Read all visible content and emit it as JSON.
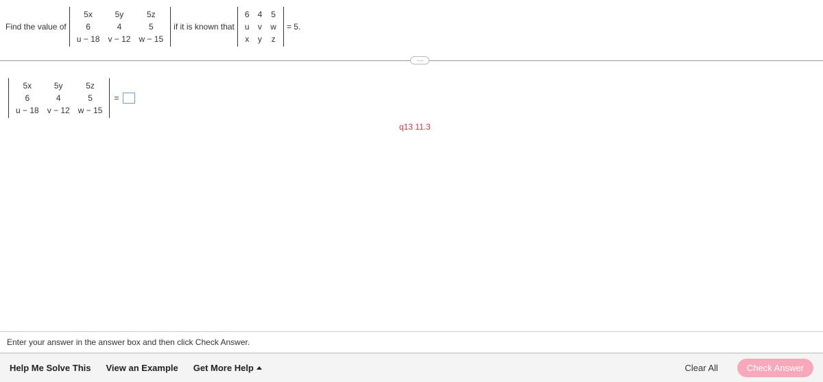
{
  "prompt": {
    "lead": "Find the value of",
    "mid": "if it is known that",
    "tail": "= 5."
  },
  "det1": {
    "cols": 3,
    "cells": [
      "5x",
      "5y",
      "5z",
      "6",
      "4",
      "5",
      "u − 18",
      "v − 12",
      "w − 15"
    ]
  },
  "det2": {
    "cols": 3,
    "cells": [
      "6",
      "4",
      "5",
      "u",
      "v",
      "w",
      "x",
      "y",
      "z"
    ]
  },
  "answer": {
    "det": {
      "cols": 3,
      "cells": [
        "5x",
        "5y",
        "5z",
        "6",
        "4",
        "5",
        "u − 18",
        "v − 12",
        "w − 15"
      ]
    },
    "eq": "=",
    "value": ""
  },
  "note": "q13 11.3",
  "instruction": "Enter your answer in the answer box and then click Check Answer.",
  "buttons": {
    "help": "Help Me Solve This",
    "example": "View an Example",
    "more": "Get More Help",
    "clear": "Clear All",
    "check": "Check Answer"
  }
}
